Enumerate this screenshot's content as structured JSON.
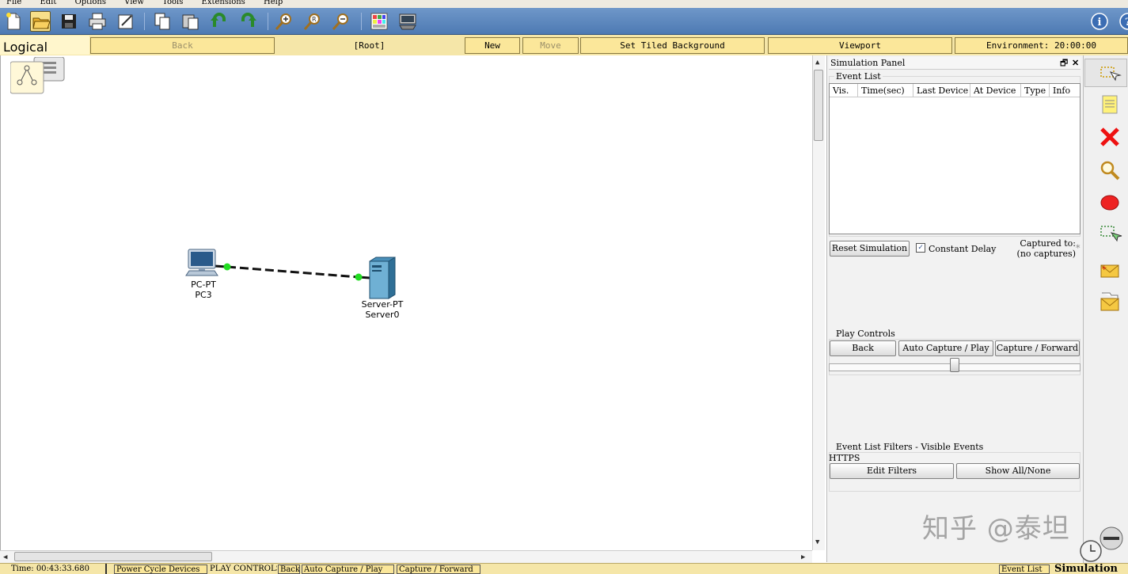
{
  "menu": [
    "File",
    "Edit",
    "Options",
    "View",
    "Tools",
    "Extensions",
    "Help"
  ],
  "toolbar_icons": [
    "new-file-icon",
    "open-folder-icon",
    "save-icon",
    "print-icon",
    "activity-wizard-icon",
    "copy-icon",
    "paste-icon",
    "undo-icon",
    "redo-icon",
    "zoom-in-icon",
    "zoom-reset-icon",
    "zoom-out-icon",
    "palette-icon",
    "custom-device-icon",
    "info-icon"
  ],
  "logical_bar": {
    "tab": "Logical",
    "back": "Back",
    "root": "[Root]",
    "new_cluster": "New Cluster",
    "move_object": "Move Object",
    "tiled_bg": "Set Tiled Background",
    "viewport": "Viewport",
    "environment": "Environment: 20:00:00"
  },
  "devices": [
    {
      "type": "PC-PT",
      "name": "PC3"
    },
    {
      "type": "Server-PT",
      "name": "Server0"
    }
  ],
  "sim_panel": {
    "title": "Simulation Panel",
    "event_list_label": "Event List",
    "columns": [
      "Vis.",
      "Time(sec)",
      "Last Device",
      "At Device",
      "Type",
      "Info"
    ],
    "reset": "Reset Simulation",
    "constant_delay": "Constant Delay",
    "captured_to": "Captured to:",
    "no_captures": "(no captures)",
    "play_controls_label": "Play Controls",
    "back": "Back",
    "auto_capture": "Auto Capture / Play",
    "capture_forward": "Capture / Forward",
    "filters_label": "Event List Filters - Visible Events",
    "filter_value": "HTTPS",
    "edit_filters": "Edit Filters",
    "show_all": "Show All/None"
  },
  "right_tools": [
    "select-icon",
    "note-icon",
    "delete-icon",
    "inspect-icon",
    "draw-ellipse-icon",
    "resize-icon",
    "simple-pdu-icon",
    "complex-pdu-icon"
  ],
  "status": {
    "time": "Time: 00:43:33.680",
    "power_cycle": "Power Cycle Devices",
    "play_controls": "PLAY CONTROLS:",
    "back": "Back",
    "auto_capture": "Auto Capture / Play",
    "capture_forward": "Capture / Forward",
    "event_list": "Event List",
    "simulation": "Simulation"
  },
  "watermark": "知乎 @泰坦",
  "colors": {
    "toolbar": "#5a86bf",
    "logical_bar": "#f5e6a8",
    "link_dot": "#22dd22"
  }
}
